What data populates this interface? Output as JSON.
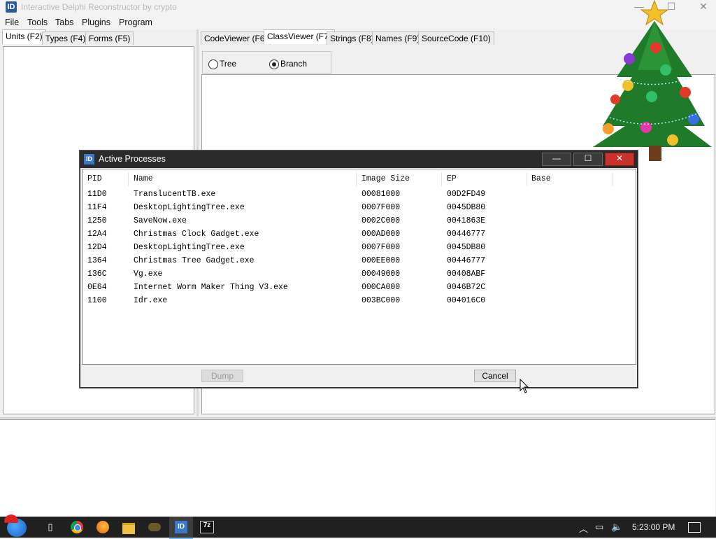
{
  "window": {
    "title": "Interactive Delphi Reconstructor by crypto",
    "min": "—",
    "max": "☐",
    "close": "✕"
  },
  "menu": [
    "File",
    "Tools",
    "Tabs",
    "Plugins",
    "Program"
  ],
  "left_tabs": [
    "Units (F2)",
    "Types (F4)",
    "Forms (F5)"
  ],
  "right_tabs": [
    "CodeViewer (F6)",
    "ClassViewer (F7)",
    "Strings (F8)",
    "Names (F9)",
    "SourceCode (F10)"
  ],
  "classviewer": {
    "tree_label": "Tree",
    "branch_label": "Branch",
    "selected": "Branch"
  },
  "dialog": {
    "title": "Active Processes",
    "columns": [
      "PID",
      "Name",
      "Image Size",
      "EP",
      "Base"
    ],
    "rows": [
      [
        "11D0",
        "TranslucentTB.exe",
        "00081000",
        "00D2FD49",
        ""
      ],
      [
        "11F4",
        "DesktopLightingTree.exe",
        "0007F000",
        "0045DB80",
        ""
      ],
      [
        "1250",
        "SaveNow.exe",
        "0002C000",
        "0041863E",
        ""
      ],
      [
        "12A4",
        "Christmas Clock Gadget.exe",
        "000AD000",
        "00446777",
        ""
      ],
      [
        "12D4",
        "DesktopLightingTree.exe",
        "0007F000",
        "0045DB80",
        ""
      ],
      [
        "1364",
        "Christmas Tree Gadget.exe",
        "000EE000",
        "00446777",
        ""
      ],
      [
        "136C",
        "Vg.exe",
        "00049000",
        "00408ABF",
        ""
      ],
      [
        "0E64",
        "Internet Worm Maker Thing V3.exe",
        "000CA000",
        "0046B72C",
        ""
      ],
      [
        "1100",
        "Idr.exe",
        "003BC000",
        "004016C0",
        ""
      ]
    ],
    "dump_label": "Dump",
    "cancel_label": "Cancel"
  },
  "taskbar": {
    "clock": "5:23:00 PM",
    "idr_label": "ID",
    "zip_label": "7z"
  },
  "colors": {
    "dialog_title": "#2b2b2b",
    "close_red": "#c8322a",
    "taskbar": "#202020"
  }
}
